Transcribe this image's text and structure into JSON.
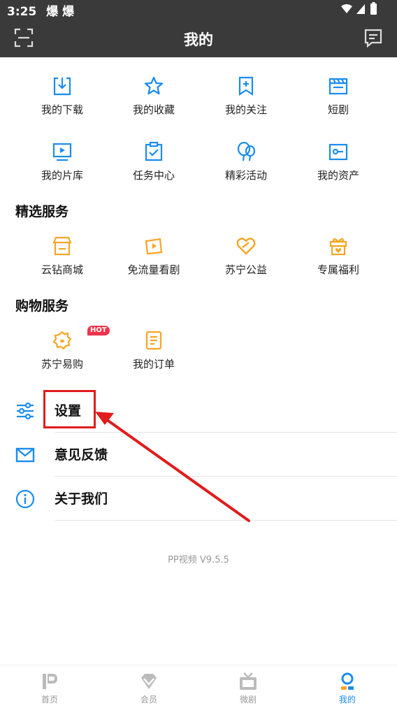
{
  "status_bar": {
    "time": "3:25",
    "notif": "爆 爆"
  },
  "header": {
    "title": "我的"
  },
  "top_grid": [
    {
      "label": "我的下载",
      "icon": "download-icon"
    },
    {
      "label": "我的收藏",
      "icon": "star-icon"
    },
    {
      "label": "我的关注",
      "icon": "bookmark-plus-icon"
    },
    {
      "label": "短剧",
      "icon": "clapperboard-icon"
    },
    {
      "label": "我的片库",
      "icon": "video-library-icon"
    },
    {
      "label": "任务中心",
      "icon": "task-clipboard-icon"
    },
    {
      "label": "精彩活动",
      "icon": "balloon-icon"
    },
    {
      "label": "我的资产",
      "icon": "wallet-icon"
    }
  ],
  "featured": {
    "title": "精选服务",
    "items": [
      {
        "label": "云钻商城",
        "icon": "store-icon"
      },
      {
        "label": "免流量看剧",
        "icon": "ticket-play-icon"
      },
      {
        "label": "苏宁公益",
        "icon": "heart-hands-icon"
      },
      {
        "label": "专属福利",
        "icon": "gift-icon"
      }
    ]
  },
  "shopping": {
    "title": "购物服务",
    "items": [
      {
        "label": "苏宁易购",
        "icon": "suning-mascot-icon",
        "badge": "HOT"
      },
      {
        "label": "我的订单",
        "icon": "order-doc-icon"
      }
    ]
  },
  "list": [
    {
      "label": "设置",
      "icon": "settings-sliders-icon"
    },
    {
      "label": "意见反馈",
      "icon": "mail-icon"
    },
    {
      "label": "关于我们",
      "icon": "info-icon"
    }
  ],
  "version": "PP视频 V9.5.5",
  "tabs": [
    {
      "label": "首页",
      "icon": "pp-logo-icon"
    },
    {
      "label": "会员",
      "icon": "diamond-icon"
    },
    {
      "label": "微剧",
      "icon": "tv-icon"
    },
    {
      "label": "我的",
      "icon": "user-icon",
      "active": true
    }
  ],
  "colors": {
    "accent": "#1a8cf0",
    "orange": "#f5a623",
    "header": "#3a3a3a",
    "highlight": "#e01c1c"
  }
}
